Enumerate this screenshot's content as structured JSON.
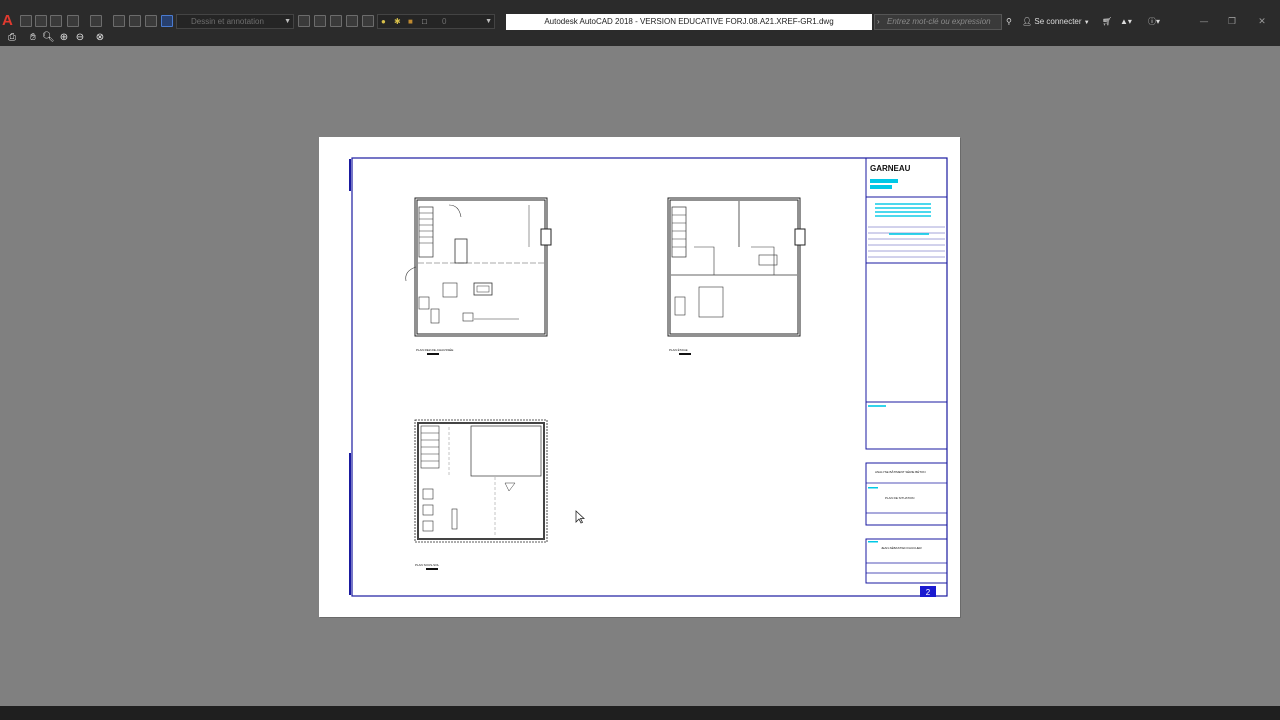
{
  "app": {
    "title": "Autodesk AutoCAD 2018 - VERSION EDUCATIVE    FORJ.08.A21.XREF-GR1.dwg",
    "logo": "A"
  },
  "quick_access": {
    "workspace_combo": "Dessin et annotation",
    "layer_combo": "0"
  },
  "search": {
    "placeholder": "Entrez mot-clé ou expression"
  },
  "account": {
    "signin_label": "Se connecter"
  },
  "colors": {
    "titlebar": "#2b2b2b",
    "canvas": "#808080",
    "paper": "#ffffff",
    "border_blue": "#1a1aa0",
    "accent_cyan": "#00c8e6"
  },
  "drawing": {
    "plan_ground_label": "PLAN REZ-DE-CHAUSSÉE",
    "plan_upper_label": "PLAN ÉTAGE",
    "plan_basement_label": "PLAN SOUS-SOL",
    "titleblock_brand": "GARNEAU",
    "titleblock_project": "ANALYSE BÂTIMENT SÉRIE BÉTON",
    "titleblock_sheet_title": "PLAN DE SITUATION",
    "titleblock_author": "JEAN-SÉBASTIEN FAUCHER",
    "sheet_number": "2"
  },
  "icons": {
    "plot": "printer-icon",
    "pan": "hand-icon",
    "zoom": "magnifier-icon",
    "zoom_window": "zoom-window-icon",
    "zoom_prev": "zoom-previous-icon",
    "close_preview": "close-circle-icon",
    "search": "binoculars-icon",
    "user": "user-icon",
    "cart": "cart-icon",
    "help": "help-icon"
  }
}
